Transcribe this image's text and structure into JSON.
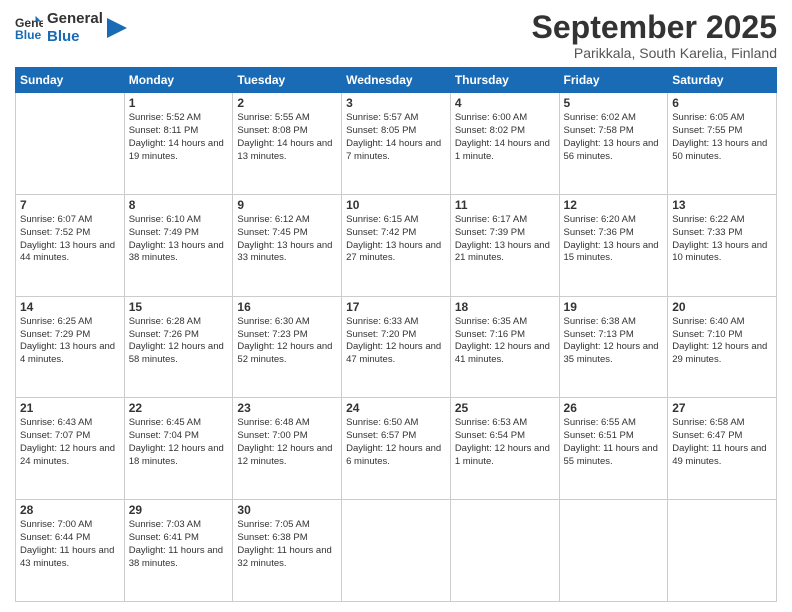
{
  "logo": {
    "line1": "General",
    "line2": "Blue"
  },
  "title": "September 2025",
  "subtitle": "Parikkala, South Karelia, Finland",
  "days_header": [
    "Sunday",
    "Monday",
    "Tuesday",
    "Wednesday",
    "Thursday",
    "Friday",
    "Saturday"
  ],
  "weeks": [
    [
      {
        "num": "",
        "info": ""
      },
      {
        "num": "1",
        "info": "Sunrise: 5:52 AM\nSunset: 8:11 PM\nDaylight: 14 hours\nand 19 minutes."
      },
      {
        "num": "2",
        "info": "Sunrise: 5:55 AM\nSunset: 8:08 PM\nDaylight: 14 hours\nand 13 minutes."
      },
      {
        "num": "3",
        "info": "Sunrise: 5:57 AM\nSunset: 8:05 PM\nDaylight: 14 hours\nand 7 minutes."
      },
      {
        "num": "4",
        "info": "Sunrise: 6:00 AM\nSunset: 8:02 PM\nDaylight: 14 hours\nand 1 minute."
      },
      {
        "num": "5",
        "info": "Sunrise: 6:02 AM\nSunset: 7:58 PM\nDaylight: 13 hours\nand 56 minutes."
      },
      {
        "num": "6",
        "info": "Sunrise: 6:05 AM\nSunset: 7:55 PM\nDaylight: 13 hours\nand 50 minutes."
      }
    ],
    [
      {
        "num": "7",
        "info": "Sunrise: 6:07 AM\nSunset: 7:52 PM\nDaylight: 13 hours\nand 44 minutes."
      },
      {
        "num": "8",
        "info": "Sunrise: 6:10 AM\nSunset: 7:49 PM\nDaylight: 13 hours\nand 38 minutes."
      },
      {
        "num": "9",
        "info": "Sunrise: 6:12 AM\nSunset: 7:45 PM\nDaylight: 13 hours\nand 33 minutes."
      },
      {
        "num": "10",
        "info": "Sunrise: 6:15 AM\nSunset: 7:42 PM\nDaylight: 13 hours\nand 27 minutes."
      },
      {
        "num": "11",
        "info": "Sunrise: 6:17 AM\nSunset: 7:39 PM\nDaylight: 13 hours\nand 21 minutes."
      },
      {
        "num": "12",
        "info": "Sunrise: 6:20 AM\nSunset: 7:36 PM\nDaylight: 13 hours\nand 15 minutes."
      },
      {
        "num": "13",
        "info": "Sunrise: 6:22 AM\nSunset: 7:33 PM\nDaylight: 13 hours\nand 10 minutes."
      }
    ],
    [
      {
        "num": "14",
        "info": "Sunrise: 6:25 AM\nSunset: 7:29 PM\nDaylight: 13 hours\nand 4 minutes."
      },
      {
        "num": "15",
        "info": "Sunrise: 6:28 AM\nSunset: 7:26 PM\nDaylight: 12 hours\nand 58 minutes."
      },
      {
        "num": "16",
        "info": "Sunrise: 6:30 AM\nSunset: 7:23 PM\nDaylight: 12 hours\nand 52 minutes."
      },
      {
        "num": "17",
        "info": "Sunrise: 6:33 AM\nSunset: 7:20 PM\nDaylight: 12 hours\nand 47 minutes."
      },
      {
        "num": "18",
        "info": "Sunrise: 6:35 AM\nSunset: 7:16 PM\nDaylight: 12 hours\nand 41 minutes."
      },
      {
        "num": "19",
        "info": "Sunrise: 6:38 AM\nSunset: 7:13 PM\nDaylight: 12 hours\nand 35 minutes."
      },
      {
        "num": "20",
        "info": "Sunrise: 6:40 AM\nSunset: 7:10 PM\nDaylight: 12 hours\nand 29 minutes."
      }
    ],
    [
      {
        "num": "21",
        "info": "Sunrise: 6:43 AM\nSunset: 7:07 PM\nDaylight: 12 hours\nand 24 minutes."
      },
      {
        "num": "22",
        "info": "Sunrise: 6:45 AM\nSunset: 7:04 PM\nDaylight: 12 hours\nand 18 minutes."
      },
      {
        "num": "23",
        "info": "Sunrise: 6:48 AM\nSunset: 7:00 PM\nDaylight: 12 hours\nand 12 minutes."
      },
      {
        "num": "24",
        "info": "Sunrise: 6:50 AM\nSunset: 6:57 PM\nDaylight: 12 hours\nand 6 minutes."
      },
      {
        "num": "25",
        "info": "Sunrise: 6:53 AM\nSunset: 6:54 PM\nDaylight: 12 hours\nand 1 minute."
      },
      {
        "num": "26",
        "info": "Sunrise: 6:55 AM\nSunset: 6:51 PM\nDaylight: 11 hours\nand 55 minutes."
      },
      {
        "num": "27",
        "info": "Sunrise: 6:58 AM\nSunset: 6:47 PM\nDaylight: 11 hours\nand 49 minutes."
      }
    ],
    [
      {
        "num": "28",
        "info": "Sunrise: 7:00 AM\nSunset: 6:44 PM\nDaylight: 11 hours\nand 43 minutes."
      },
      {
        "num": "29",
        "info": "Sunrise: 7:03 AM\nSunset: 6:41 PM\nDaylight: 11 hours\nand 38 minutes."
      },
      {
        "num": "30",
        "info": "Sunrise: 7:05 AM\nSunset: 6:38 PM\nDaylight: 11 hours\nand 32 minutes."
      },
      {
        "num": "",
        "info": ""
      },
      {
        "num": "",
        "info": ""
      },
      {
        "num": "",
        "info": ""
      },
      {
        "num": "",
        "info": ""
      }
    ]
  ]
}
